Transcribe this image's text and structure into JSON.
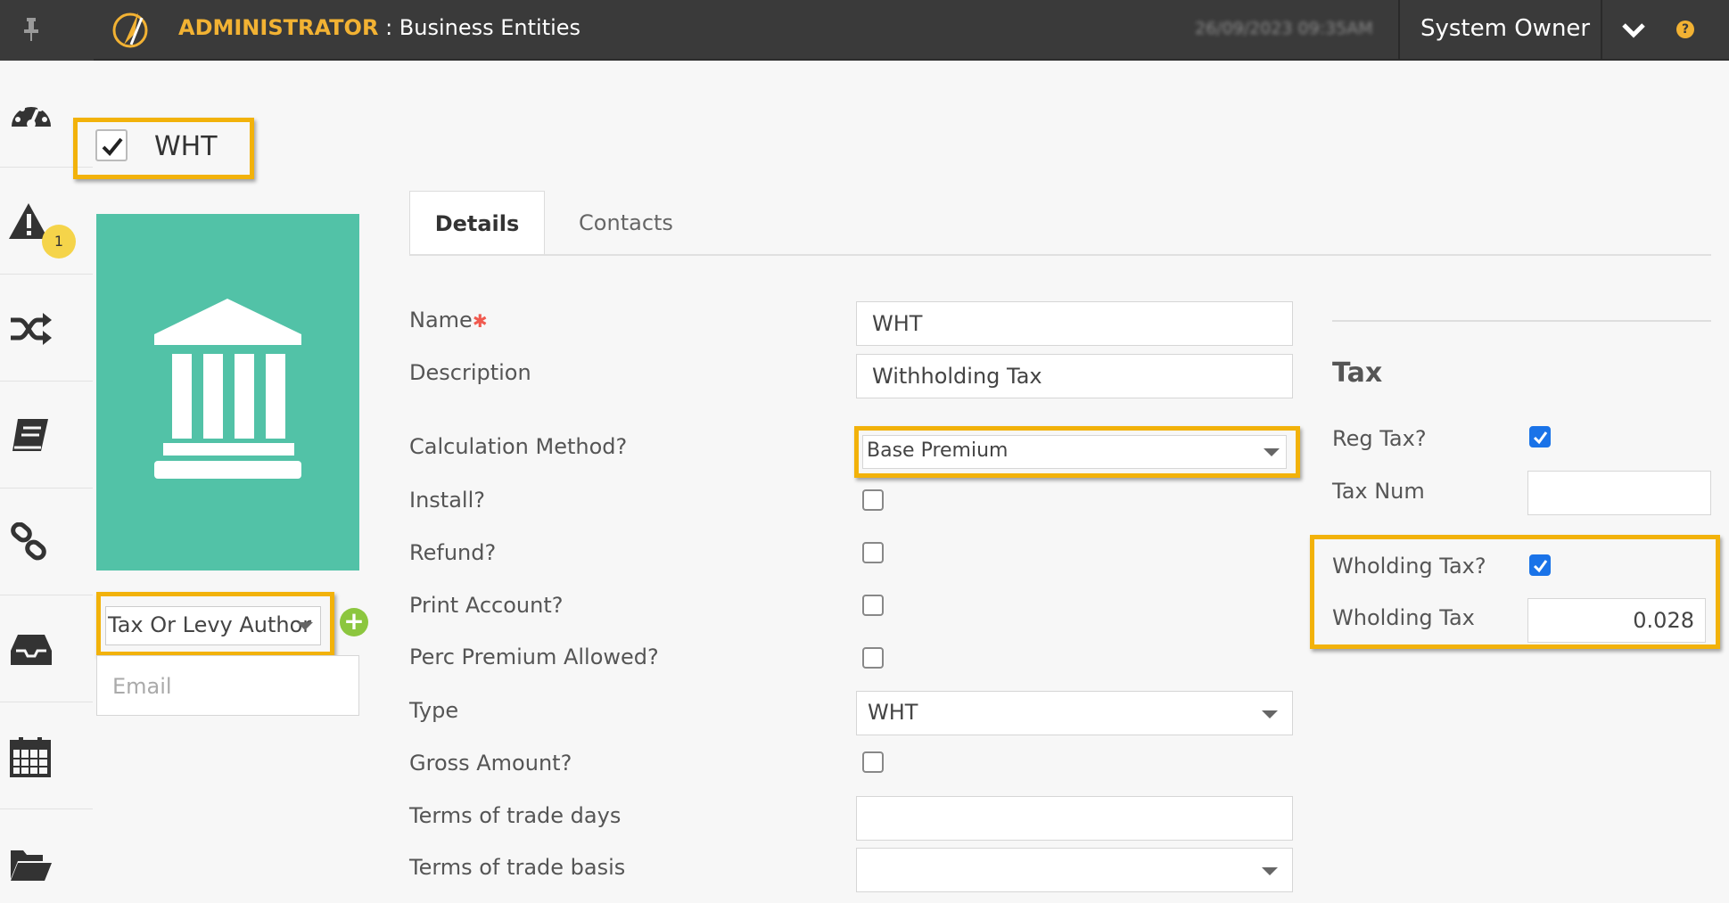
{
  "header": {
    "admin_label": "ADMINISTRATOR",
    "separator": " : ",
    "section": "Business Entities",
    "datetime": "26/09/2023 09:35AM",
    "user": "System Owner"
  },
  "sidebar": {
    "items": [
      "dashboard",
      "alerts",
      "workflow",
      "ledger",
      "links",
      "inbox",
      "calendar",
      "documents"
    ],
    "alerts_badge": "1"
  },
  "entity": {
    "checked": true,
    "name": "WHT",
    "type_select": "Tax Or Levy Author",
    "email_placeholder": "Email"
  },
  "tabs": [
    {
      "label": "Details",
      "active": true
    },
    {
      "label": "Contacts",
      "active": false
    }
  ],
  "details": {
    "name_label": "Name",
    "required_mark": "✱",
    "name_value": "WHT",
    "description_label": "Description",
    "description_value": "Withholding Tax",
    "calc_method_label": "Calculation Method?",
    "calc_method_value": "Base Premium",
    "install_label": "Install?",
    "install_checked": false,
    "refund_label": "Refund?",
    "refund_checked": false,
    "print_account_label": "Print Account?",
    "print_account_checked": false,
    "perc_premium_label": "Perc Premium Allowed?",
    "perc_premium_checked": false,
    "type_label": "Type",
    "type_value": "WHT",
    "gross_amount_label": "Gross Amount?",
    "gross_amount_checked": false,
    "terms_days_label": "Terms of trade days",
    "terms_days_value": "",
    "terms_basis_label": "Terms of trade basis",
    "terms_basis_value": ""
  },
  "tax": {
    "heading": "Tax",
    "reg_tax_label": "Reg Tax?",
    "reg_tax_checked": true,
    "tax_num_label": "Tax Num",
    "tax_num_value": "",
    "wholding_tax_label": "Wholding Tax?",
    "wholding_tax_checked": true,
    "wholding_rate_label": "Wholding Tax",
    "wholding_rate_value": "0.028"
  },
  "colors": {
    "topbar": "#3a3a3a",
    "accent": "#f2b233",
    "highlight": "#f2b20a",
    "entity_tile": "#52c2a7",
    "checkbox_blue": "#1a73e8",
    "add_green": "#8cc63f",
    "required_red": "#f05a4f"
  }
}
